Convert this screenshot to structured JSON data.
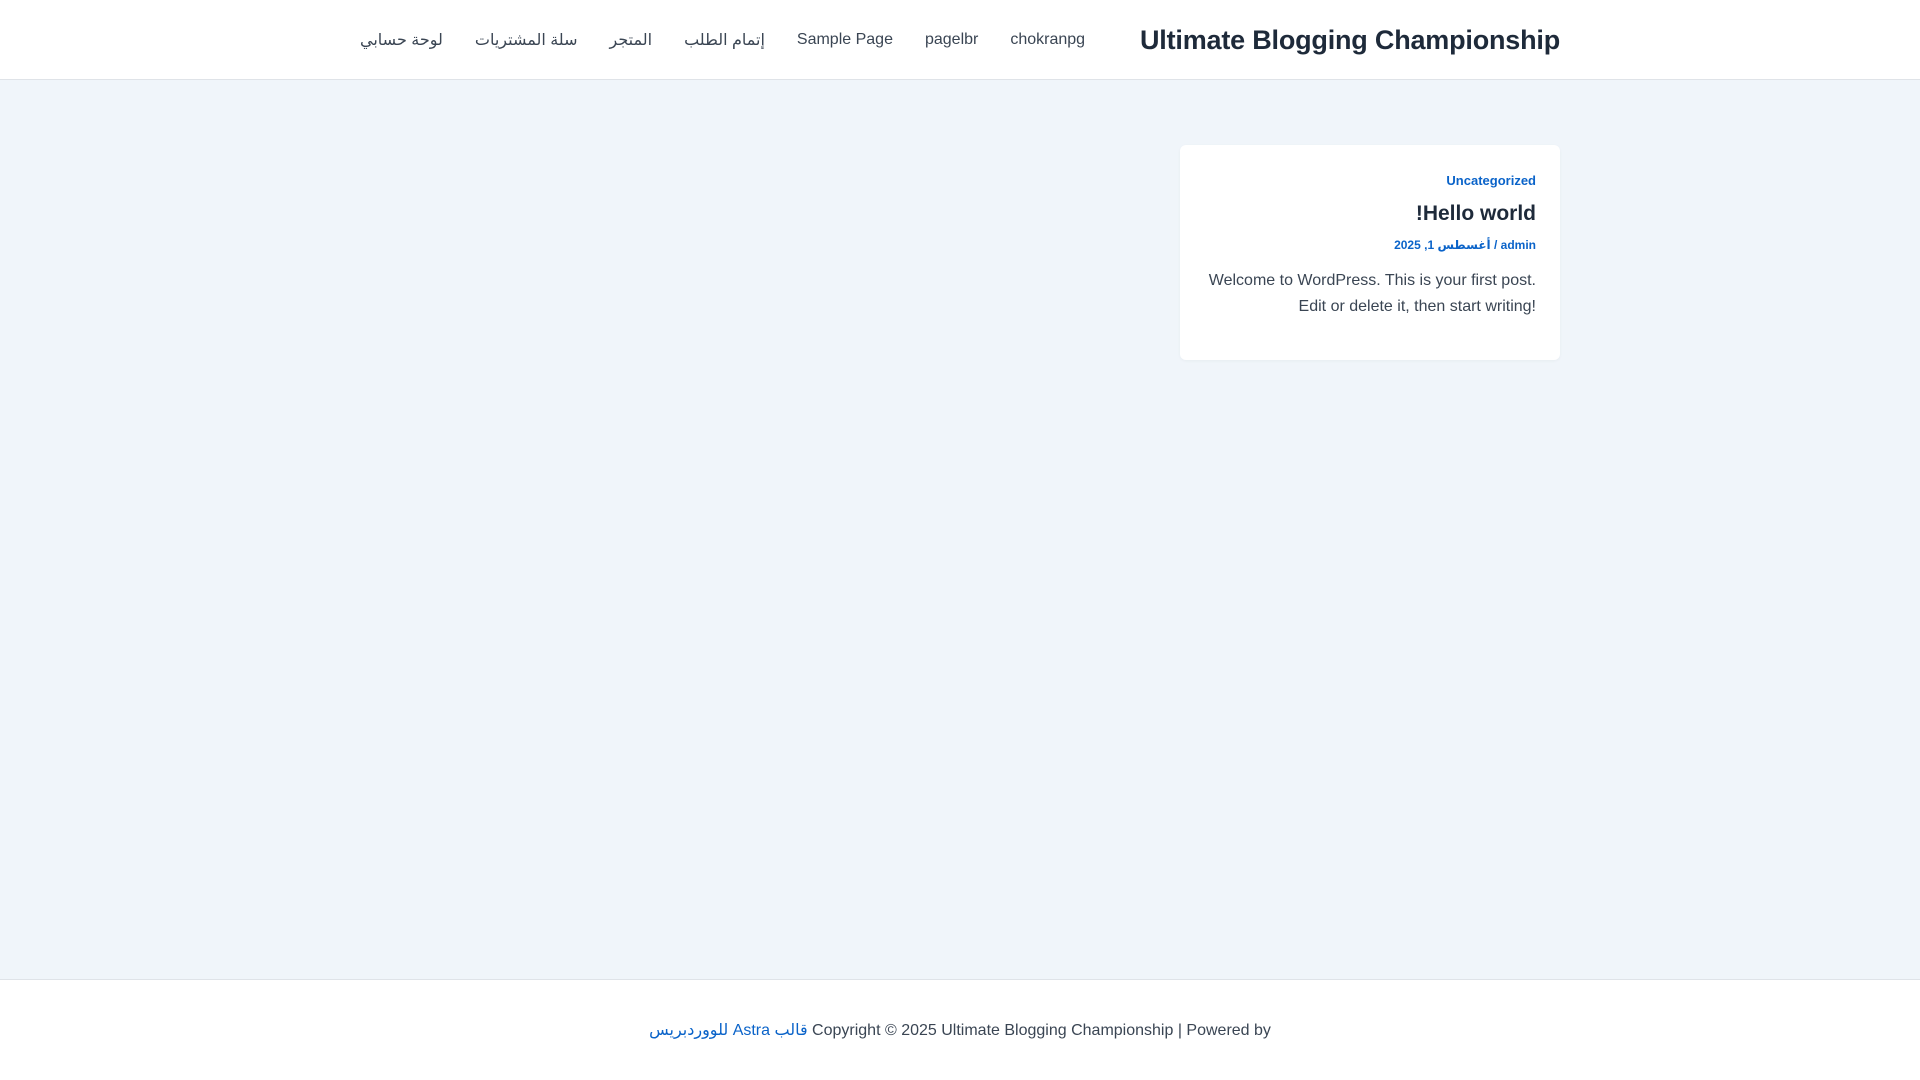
{
  "header": {
    "site_title": "Ultimate Blogging Championship",
    "nav": [
      {
        "label": "chokranpg"
      },
      {
        "label": "pagelbr"
      },
      {
        "label": "Sample Page"
      },
      {
        "label": "إتمام الطلب"
      },
      {
        "label": "المتجر"
      },
      {
        "label": "سلة المشتريات"
      },
      {
        "label": "لوحة حسابي"
      }
    ]
  },
  "post": {
    "category": "Uncategorized",
    "title": "Hello world!",
    "author": "admin",
    "separator": " / ",
    "date": "أغسطس 1, 2025",
    "excerpt_line1": "Welcome to WordPress. This is your first post.",
    "excerpt_line2": "Edit or delete it, then start writing!"
  },
  "footer": {
    "copyright": "Copyright © 2025 Ultimate Blogging Championship | Powered by ",
    "theme_link": "قالب Astra للووردبريس"
  },
  "colors": {
    "accent": "#0a63c9",
    "heading": "#1e2a3a",
    "background": "#f0f5fa"
  }
}
